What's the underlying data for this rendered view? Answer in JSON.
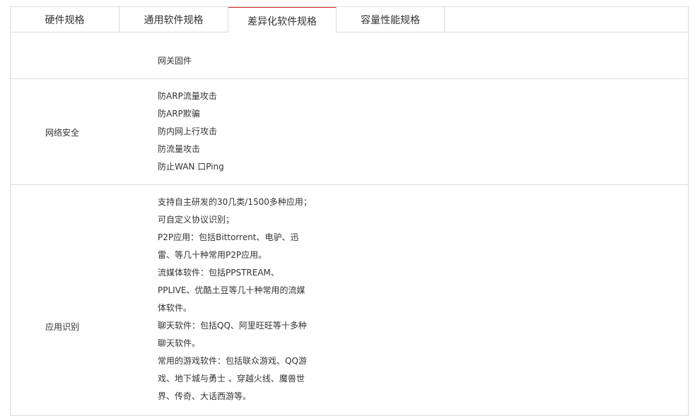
{
  "tabs": [
    {
      "label": "硬件规格",
      "active": false
    },
    {
      "label": "通用软件规格",
      "active": false
    },
    {
      "label": "差异化软件规格",
      "active": true
    },
    {
      "label": "容量性能规格",
      "active": false
    }
  ],
  "accent_color": "#e0262d",
  "rows": [
    {
      "label": "",
      "lines": [
        "网关固件"
      ]
    },
    {
      "label": "网络安全",
      "lines": [
        "防ARP流量攻击",
        "防ARP欺骗",
        "防内网上行攻击",
        "防流量攻击",
        "防止WAN 口Ping"
      ]
    },
    {
      "label": "应用识别",
      "lines": [
        "支持自主研发的30几类/1500多种应用；",
        "可自定义协议识别；",
        "P2P应用：包括Bittorrent、电驴、迅",
        "雷、等几十种常用P2P应用。",
        "流媒体软件：包括PPSTREAM、",
        "PPLIVE、优酷土豆等几十种常用的流媒",
        "体软件。",
        "聊天软件：包括QQ、阿里旺旺等十多种",
        "聊天软件。",
        "常用的游戏软件：包括联众游戏、QQ游",
        "戏、地下城与勇士 、穿越火线、魔兽世",
        "界、传奇、大话西游等。"
      ]
    }
  ]
}
